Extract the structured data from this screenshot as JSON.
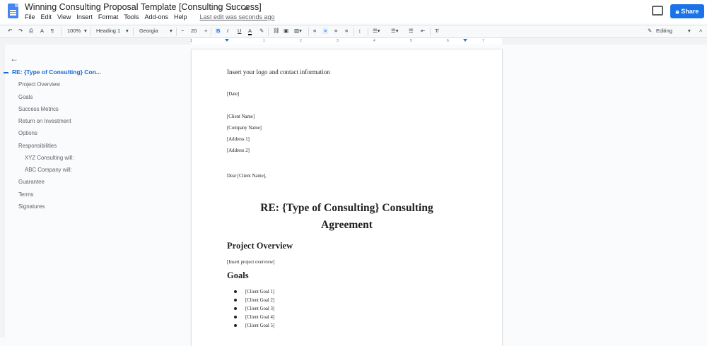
{
  "doc": {
    "title": "Winning Consulting Proposal Template [Consulting Success]",
    "last_edit": "Last edit was seconds ago",
    "share_label": "Share"
  },
  "menu": [
    "File",
    "Edit",
    "View",
    "Insert",
    "Format",
    "Tools",
    "Add-ons",
    "Help"
  ],
  "toolbar": {
    "zoom": "100%",
    "style": "Heading 1",
    "font": "Georgia",
    "font_size": "20",
    "mode": "Editing"
  },
  "ruler": [
    "1",
    "1",
    "2",
    "3",
    "4",
    "5",
    "6",
    "7"
  ],
  "outline": {
    "title": "RE: {Type of Consulting} Con...",
    "items": [
      "Project Overview",
      "Goals",
      "Success Metrics",
      "Return on Investment",
      "Options",
      "Responsibilities",
      "XYZ Consulting will:",
      "ABC Company will:",
      "Guarantee",
      "Terms",
      "Signatures"
    ]
  },
  "page": {
    "logo_line": "Insert your logo and contact information",
    "date": "[Date]",
    "client_name": "[Client Name]",
    "company_name": "[Company Name]",
    "address1": "[Address 1]",
    "address2": "[Address 2]",
    "salutation": "Dear [Client Name],",
    "heading_line1": "RE: {Type of Consulting} Consulting",
    "heading_line2": "Agreement",
    "project_overview_heading": "Project Overview",
    "project_overview_text": "[Insert project overview]",
    "goals_heading": "Goals",
    "goals": [
      "[Client Goal 1]",
      "[Client Goal 2]",
      "[Client Goal 3]",
      "[Client Goal 4]",
      "[Client Goal 5]"
    ]
  }
}
